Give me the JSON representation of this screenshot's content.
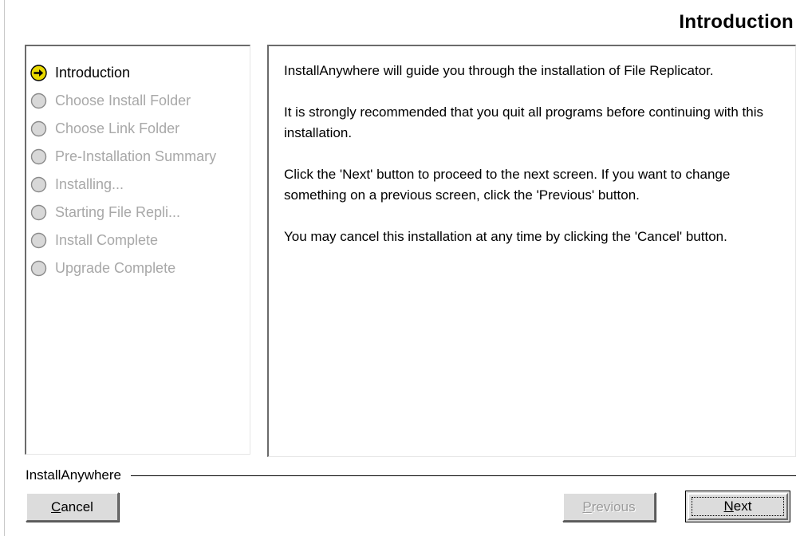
{
  "header": {
    "title": "Introduction"
  },
  "steps": [
    {
      "label": "Introduction",
      "state": "current",
      "icon": "arrow-right-circle-icon"
    },
    {
      "label": "Choose Install Folder",
      "state": "pending",
      "icon": "empty-circle-icon"
    },
    {
      "label": "Choose Link Folder",
      "state": "pending",
      "icon": "empty-circle-icon"
    },
    {
      "label": "Pre-Installation Summary",
      "state": "pending",
      "icon": "empty-circle-icon"
    },
    {
      "label": "Installing...",
      "state": "pending",
      "icon": "empty-circle-icon"
    },
    {
      "label": "Starting File Repli...",
      "state": "pending",
      "icon": "empty-circle-icon"
    },
    {
      "label": "Install Complete",
      "state": "pending",
      "icon": "empty-circle-icon"
    },
    {
      "label": "Upgrade Complete",
      "state": "pending",
      "icon": "empty-circle-icon"
    }
  ],
  "content": {
    "paragraphs": [
      "InstallAnywhere will guide you through the installation of File Replicator.",
      "It is strongly recommended that you quit all programs before continuing with this installation.",
      "Click the 'Next' button to proceed to the next screen. If you want to change something on a previous screen, click the 'Previous' button.",
      "You may cancel this installation at any time by clicking the 'Cancel' button."
    ]
  },
  "footer": {
    "brand": "InstallAnywhere",
    "cancel": {
      "mnemonic": "C",
      "rest": "ancel"
    },
    "previous": {
      "mnemonic": "P",
      "rest": "revious",
      "enabled": false
    },
    "next": {
      "mnemonic": "N",
      "rest": "ext",
      "focused": true
    }
  },
  "colors": {
    "current_step_icon": "#e8d800",
    "pending_step_icon": "#d8d8d8",
    "pending_step_text": "#a8a8a8",
    "button_face": "#dcdcdc",
    "disabled_text": "#9a9a9a"
  }
}
